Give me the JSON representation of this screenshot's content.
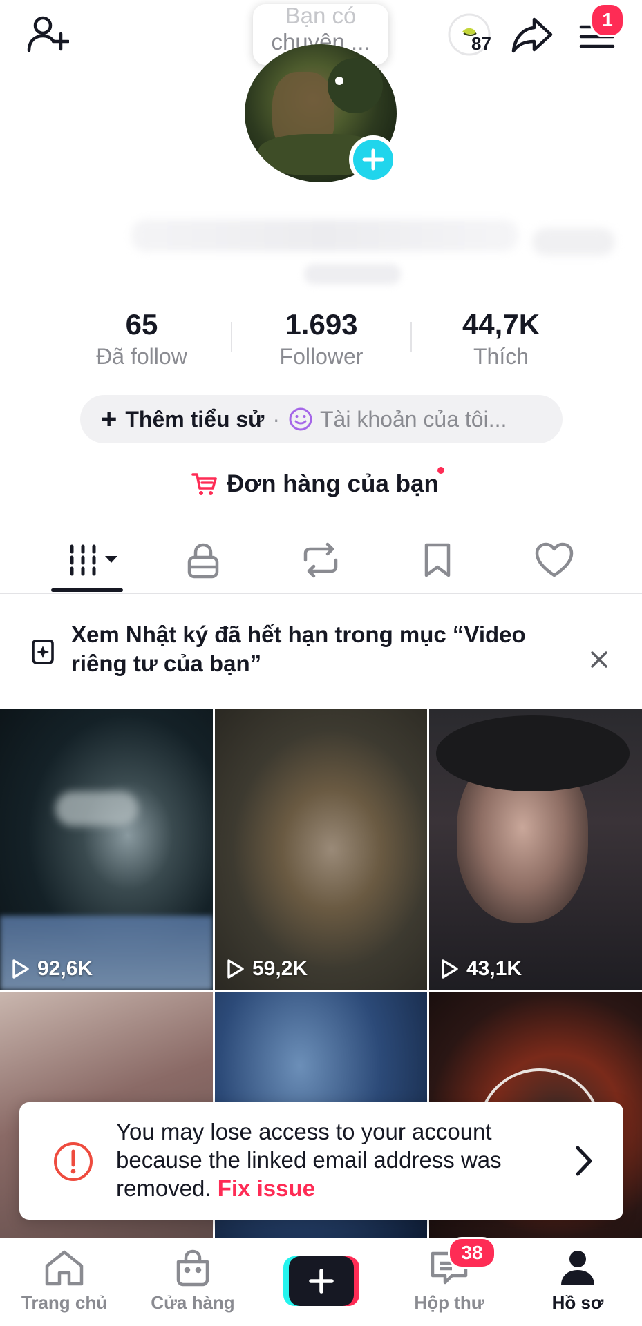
{
  "header": {
    "note_faded": "Bạn có",
    "note_text": "chuyện ...",
    "coin_count": "87",
    "menu_badge": "1"
  },
  "stats": [
    {
      "value": "65",
      "label": "Đã follow"
    },
    {
      "value": "1.693",
      "label": "Follower"
    },
    {
      "value": "44,7K",
      "label": "Thích"
    }
  ],
  "bio": {
    "add_bio": "Thêm tiểu sử",
    "separator": "·",
    "account": "Tài khoản của tôi..."
  },
  "orders": {
    "label": "Đơn hàng của bạn"
  },
  "notice": {
    "text": "Xem Nhật ký đã hết hạn trong mục “Video riêng tư của bạn”"
  },
  "videos": [
    {
      "views": "92,6K"
    },
    {
      "views": "59,2K"
    },
    {
      "views": "43,1K"
    }
  ],
  "banner": {
    "message": "You may lose access to your account because the linked email address was removed.",
    "action": "Fix issue"
  },
  "nav": {
    "home": "Trang chủ",
    "shop": "Cửa hàng",
    "inbox": "Hộp thư",
    "inbox_badge": "38",
    "profile": "Hồ sơ"
  },
  "colors": {
    "accent": "#fe2c55",
    "cyan": "#20d5ec",
    "text": "#161823",
    "muted": "#8a8b91"
  }
}
